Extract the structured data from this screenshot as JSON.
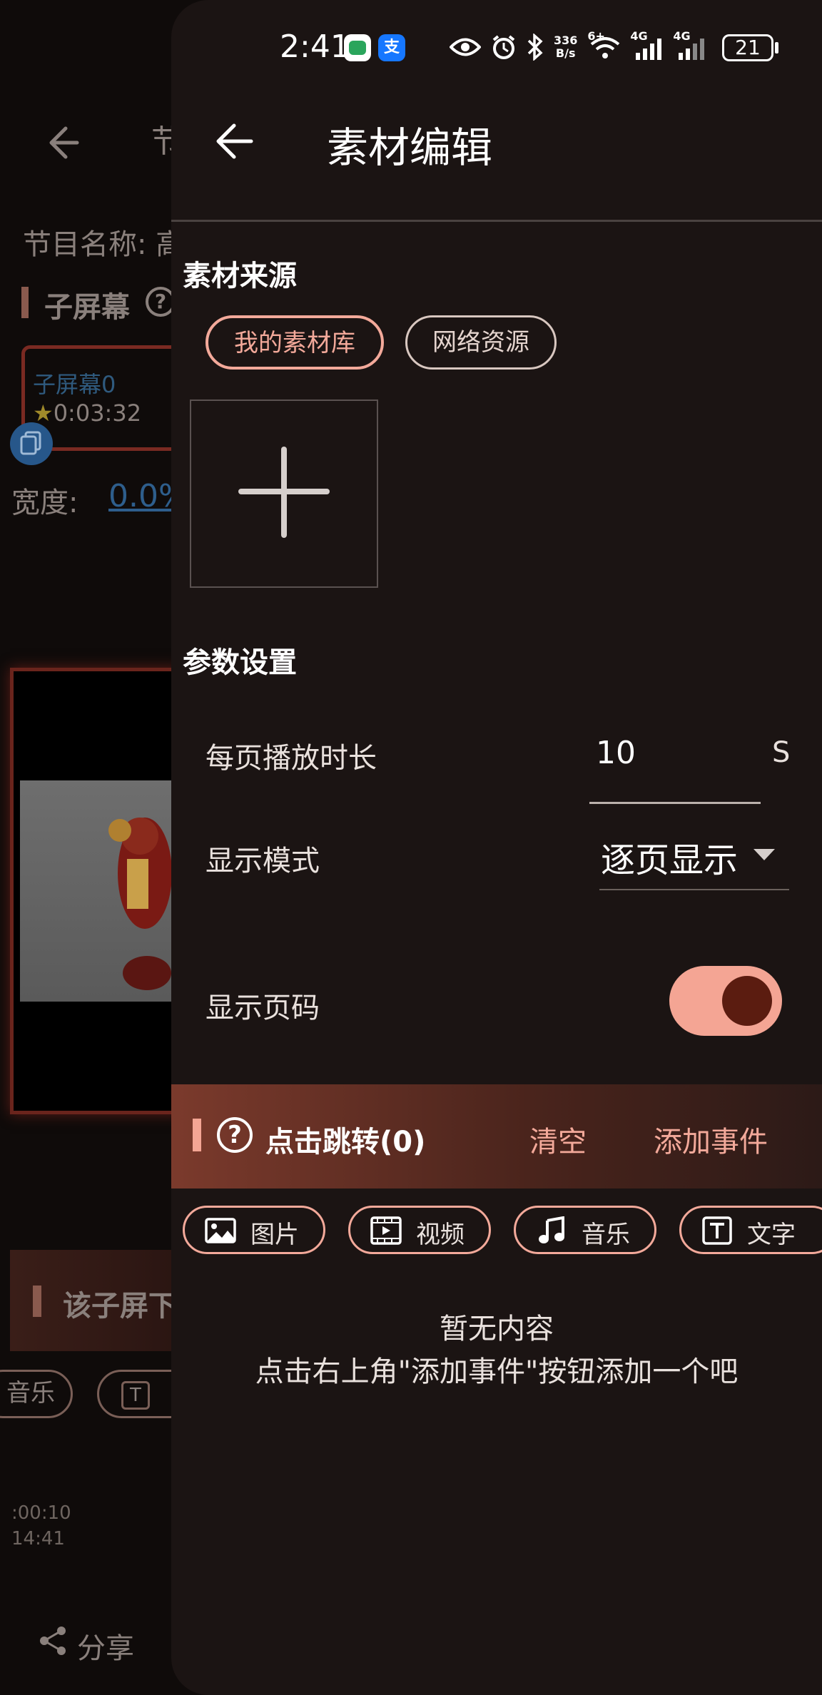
{
  "background": {
    "title_fragment": "节",
    "program_label": "节目名称: 高",
    "sub_screen_title": "子屏幕",
    "card_name": "子屏幕0",
    "card_time": "0:03:32",
    "width_label": "宽度:",
    "width_value": "0.0%",
    "strip_text": "该子屏下",
    "chip_music_fragment": "音乐",
    "chip_text_fragment": "文",
    "time_line1": ":00:10",
    "time_line2": "14:41",
    "share_label": "分享",
    "star": "★"
  },
  "status_bar": {
    "time": "2:41",
    "alipay_badge": "支",
    "net_speed_top": "336",
    "net_speed_bottom": "B/s",
    "wifi_tag": "6+",
    "sim1": "4G",
    "sim2": "4G",
    "battery": "21"
  },
  "header": {
    "title": "素材编辑"
  },
  "material_source": {
    "title": "素材来源",
    "tabs": [
      {
        "label": "我的素材库",
        "selected": true
      },
      {
        "label": "网络资源",
        "selected": false
      }
    ]
  },
  "params": {
    "title": "参数设置",
    "duration_label": "每页播放时长",
    "duration_value": "10",
    "duration_unit": "S",
    "mode_label": "显示模式",
    "mode_value": "逐页显示",
    "page_number_label": "显示页码",
    "page_number_on": true,
    "toggle_color": "#f4a594"
  },
  "events": {
    "help": "?",
    "title": "点击跳转(0)",
    "clear_label": "清空",
    "add_label": "添加事件",
    "types": [
      {
        "label": "图片",
        "icon": "image-icon"
      },
      {
        "label": "视频",
        "icon": "video-icon"
      },
      {
        "label": "音乐",
        "icon": "music-note-icon"
      },
      {
        "label": "文字",
        "icon": "text-icon"
      }
    ],
    "empty_line1": "暂无内容",
    "empty_line2": "点击右上角\"添加事件\"按钮添加一个吧"
  },
  "colors": {
    "accent": "#f3a99a",
    "drawer_bg": "#1b1413"
  }
}
